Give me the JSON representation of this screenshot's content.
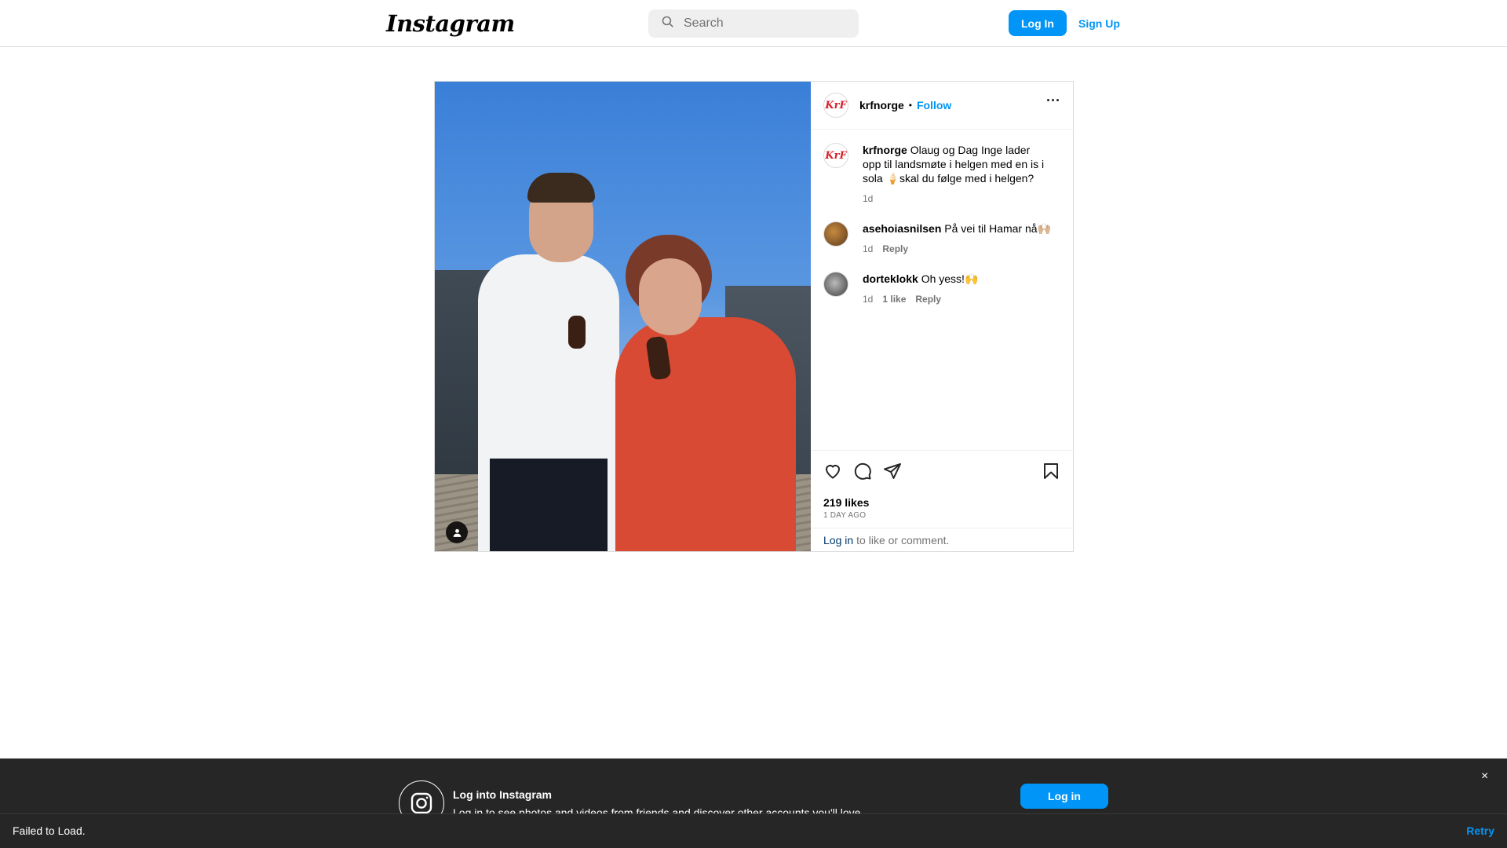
{
  "nav": {
    "logo_text": "Instagram",
    "search_placeholder": "Search",
    "login_label": "Log In",
    "signup_label": "Sign Up"
  },
  "post": {
    "author": "krfnorge",
    "author_avatar_text": "KrF",
    "follow_label": "Follow",
    "separator": "•",
    "caption": {
      "username": "krfnorge",
      "text": "Olaug og Dag Inge lader opp til landsmøte i helgen med en is i sola 🍦skal du følge med i helgen?",
      "time": "1d"
    },
    "comments": [
      {
        "username": "asehoiasnilsen",
        "text": "På vei til Hamar nå🙌🏼",
        "time": "1d",
        "likes": "",
        "reply": "Reply"
      },
      {
        "username": "dorteklokk",
        "text": "Oh yess!🙌",
        "time": "1d",
        "likes": "1 like",
        "reply": "Reply"
      }
    ],
    "likes": "219 likes",
    "posted_ago": "1 DAY AGO",
    "login_link": "Log in",
    "login_prompt": "to like or comment."
  },
  "banner": {
    "title": "Log into Instagram",
    "subtitle": "Log in to see photos and videos from friends and discover other accounts you'll love.",
    "login_button": "Log in",
    "close": "×"
  },
  "toast": {
    "message": "Failed to Load.",
    "retry": "Retry"
  },
  "colors": {
    "accent": "#0095f6",
    "brand_red": "#d8202b",
    "banner_bg": "#262626"
  },
  "icons": [
    "search-icon",
    "more-options-icon",
    "heart-icon",
    "comment-icon",
    "share-icon",
    "bookmark-icon",
    "user-tag-icon",
    "instagram-camera-icon",
    "close-icon"
  ]
}
